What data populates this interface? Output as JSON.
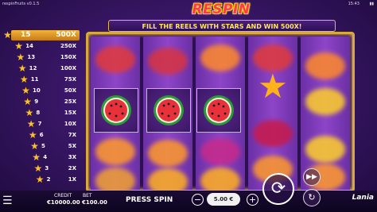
{
  "app": {
    "version": "respinFruits v0.1.5",
    "clock": "15:43",
    "signal": "▮▮"
  },
  "logo": {
    "text": "RESPIN FRUITS"
  },
  "banner": {
    "text": "FILL THE REELS WITH STARS AND WIN 500X!"
  },
  "paytable": [
    {
      "stars": "15",
      "multiplier": "500X"
    },
    {
      "stars": "14",
      "multiplier": "250X"
    },
    {
      "stars": "13",
      "multiplier": "150X"
    },
    {
      "stars": "12",
      "multiplier": "100X"
    },
    {
      "stars": "11",
      "multiplier": "75X"
    },
    {
      "stars": "10",
      "multiplier": "50X"
    },
    {
      "stars": "9",
      "multiplier": "25X"
    },
    {
      "stars": "8",
      "multiplier": "15X"
    },
    {
      "stars": "7",
      "multiplier": "10X"
    },
    {
      "stars": "6",
      "multiplier": "7X"
    },
    {
      "stars": "5",
      "multiplier": "5X"
    },
    {
      "stars": "4",
      "multiplier": "3X"
    },
    {
      "stars": "3",
      "multiplier": "2X"
    },
    {
      "stars": "2",
      "multiplier": "1X"
    }
  ],
  "reels": {
    "watermelon_icons": [
      "watermelon-icon",
      "watermelon-icon",
      "watermelon-icon"
    ]
  },
  "controls": {
    "credit_label": "CREDIT",
    "credit_value": "€10000.00",
    "bet_label": "BET",
    "bet_value": "€100.00",
    "press_spin": "PRESS SPIN",
    "bet_amount": "5.00 €",
    "minus": "−",
    "plus": "+",
    "spin_glyph": "⟳",
    "turbo_glyph": "▶▶",
    "auto_glyph": "↻"
  },
  "brand": {
    "text": "Lania"
  },
  "colors": {
    "accent": "#d9a940",
    "banner_text": "#ffe36a",
    "paytable_top": "#f3b43a",
    "star": "#ffc21a"
  }
}
